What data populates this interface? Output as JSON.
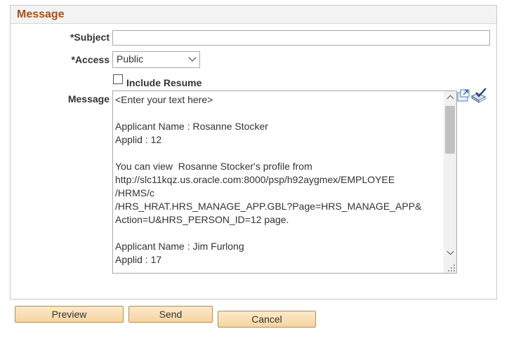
{
  "section": {
    "title": "Message"
  },
  "form": {
    "subject": {
      "label": "*Subject",
      "value": ""
    },
    "access": {
      "label": "*Access",
      "selected": "Public"
    },
    "include_resume": {
      "label": "Include Resume",
      "checked": false
    },
    "message": {
      "label": "Message",
      "text": "<Enter your text here>\n\nApplicant Name : Rosanne Stocker\nApplid : 12\n\nYou can view  Rosanne Stocker's profile from\nhttp://slc11kqz.us.oracle.com:8000/psp/h92aygmex/EMPLOYEE\n/HRMS/c\n/HRS_HRAT.HRS_MANAGE_APP.GBL?Page=HRS_MANAGE_APP&\nAction=U&HRS_PERSON_ID=12 page.\n\nApplicant Name : Jim Furlong\nApplid : 17"
    }
  },
  "icons": {
    "expand": "expand-window-icon",
    "spellcheck": "spell-check-icon"
  },
  "buttons": {
    "preview": "Preview",
    "send": "Send",
    "cancel": "Cancel"
  },
  "colors": {
    "section_title": "#a84f18",
    "button_bg": "#f6d4a0",
    "button_border": "#b58d55"
  }
}
